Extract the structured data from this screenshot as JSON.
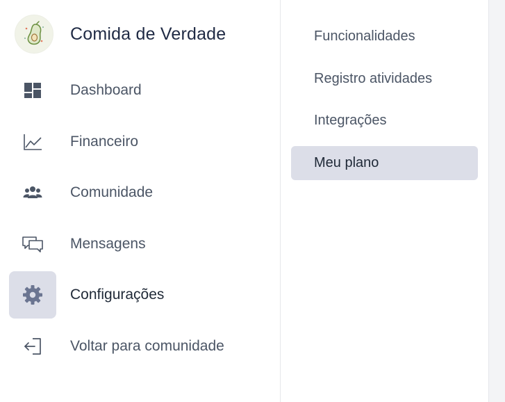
{
  "brand": {
    "name": "Comida de Verdade",
    "logo_icon": "avocado-icon"
  },
  "sidebar": {
    "items": [
      {
        "label": "Dashboard",
        "icon": "dashboard-icon",
        "active": false
      },
      {
        "label": "Financeiro",
        "icon": "line-chart-icon",
        "active": false
      },
      {
        "label": "Comunidade",
        "icon": "users-icon",
        "active": false
      },
      {
        "label": "Mensagens",
        "icon": "chat-bubbles-icon",
        "active": false
      },
      {
        "label": "Configurações",
        "icon": "gear-icon",
        "active": true
      },
      {
        "label": "Voltar para comunidade",
        "icon": "exit-arrow-icon",
        "active": false
      }
    ]
  },
  "submenu": {
    "items": [
      {
        "label": "Funcionalidades",
        "active": false
      },
      {
        "label": "Registro atividades",
        "active": false
      },
      {
        "label": "Integrações",
        "active": false
      },
      {
        "label": "Meu plano",
        "active": true
      }
    ]
  },
  "colors": {
    "active_bg": "#dcdee8",
    "icon_color": "#4b5565",
    "active_icon_color": "#6b7591",
    "text": "#4b5565",
    "title": "#1f2a44"
  }
}
